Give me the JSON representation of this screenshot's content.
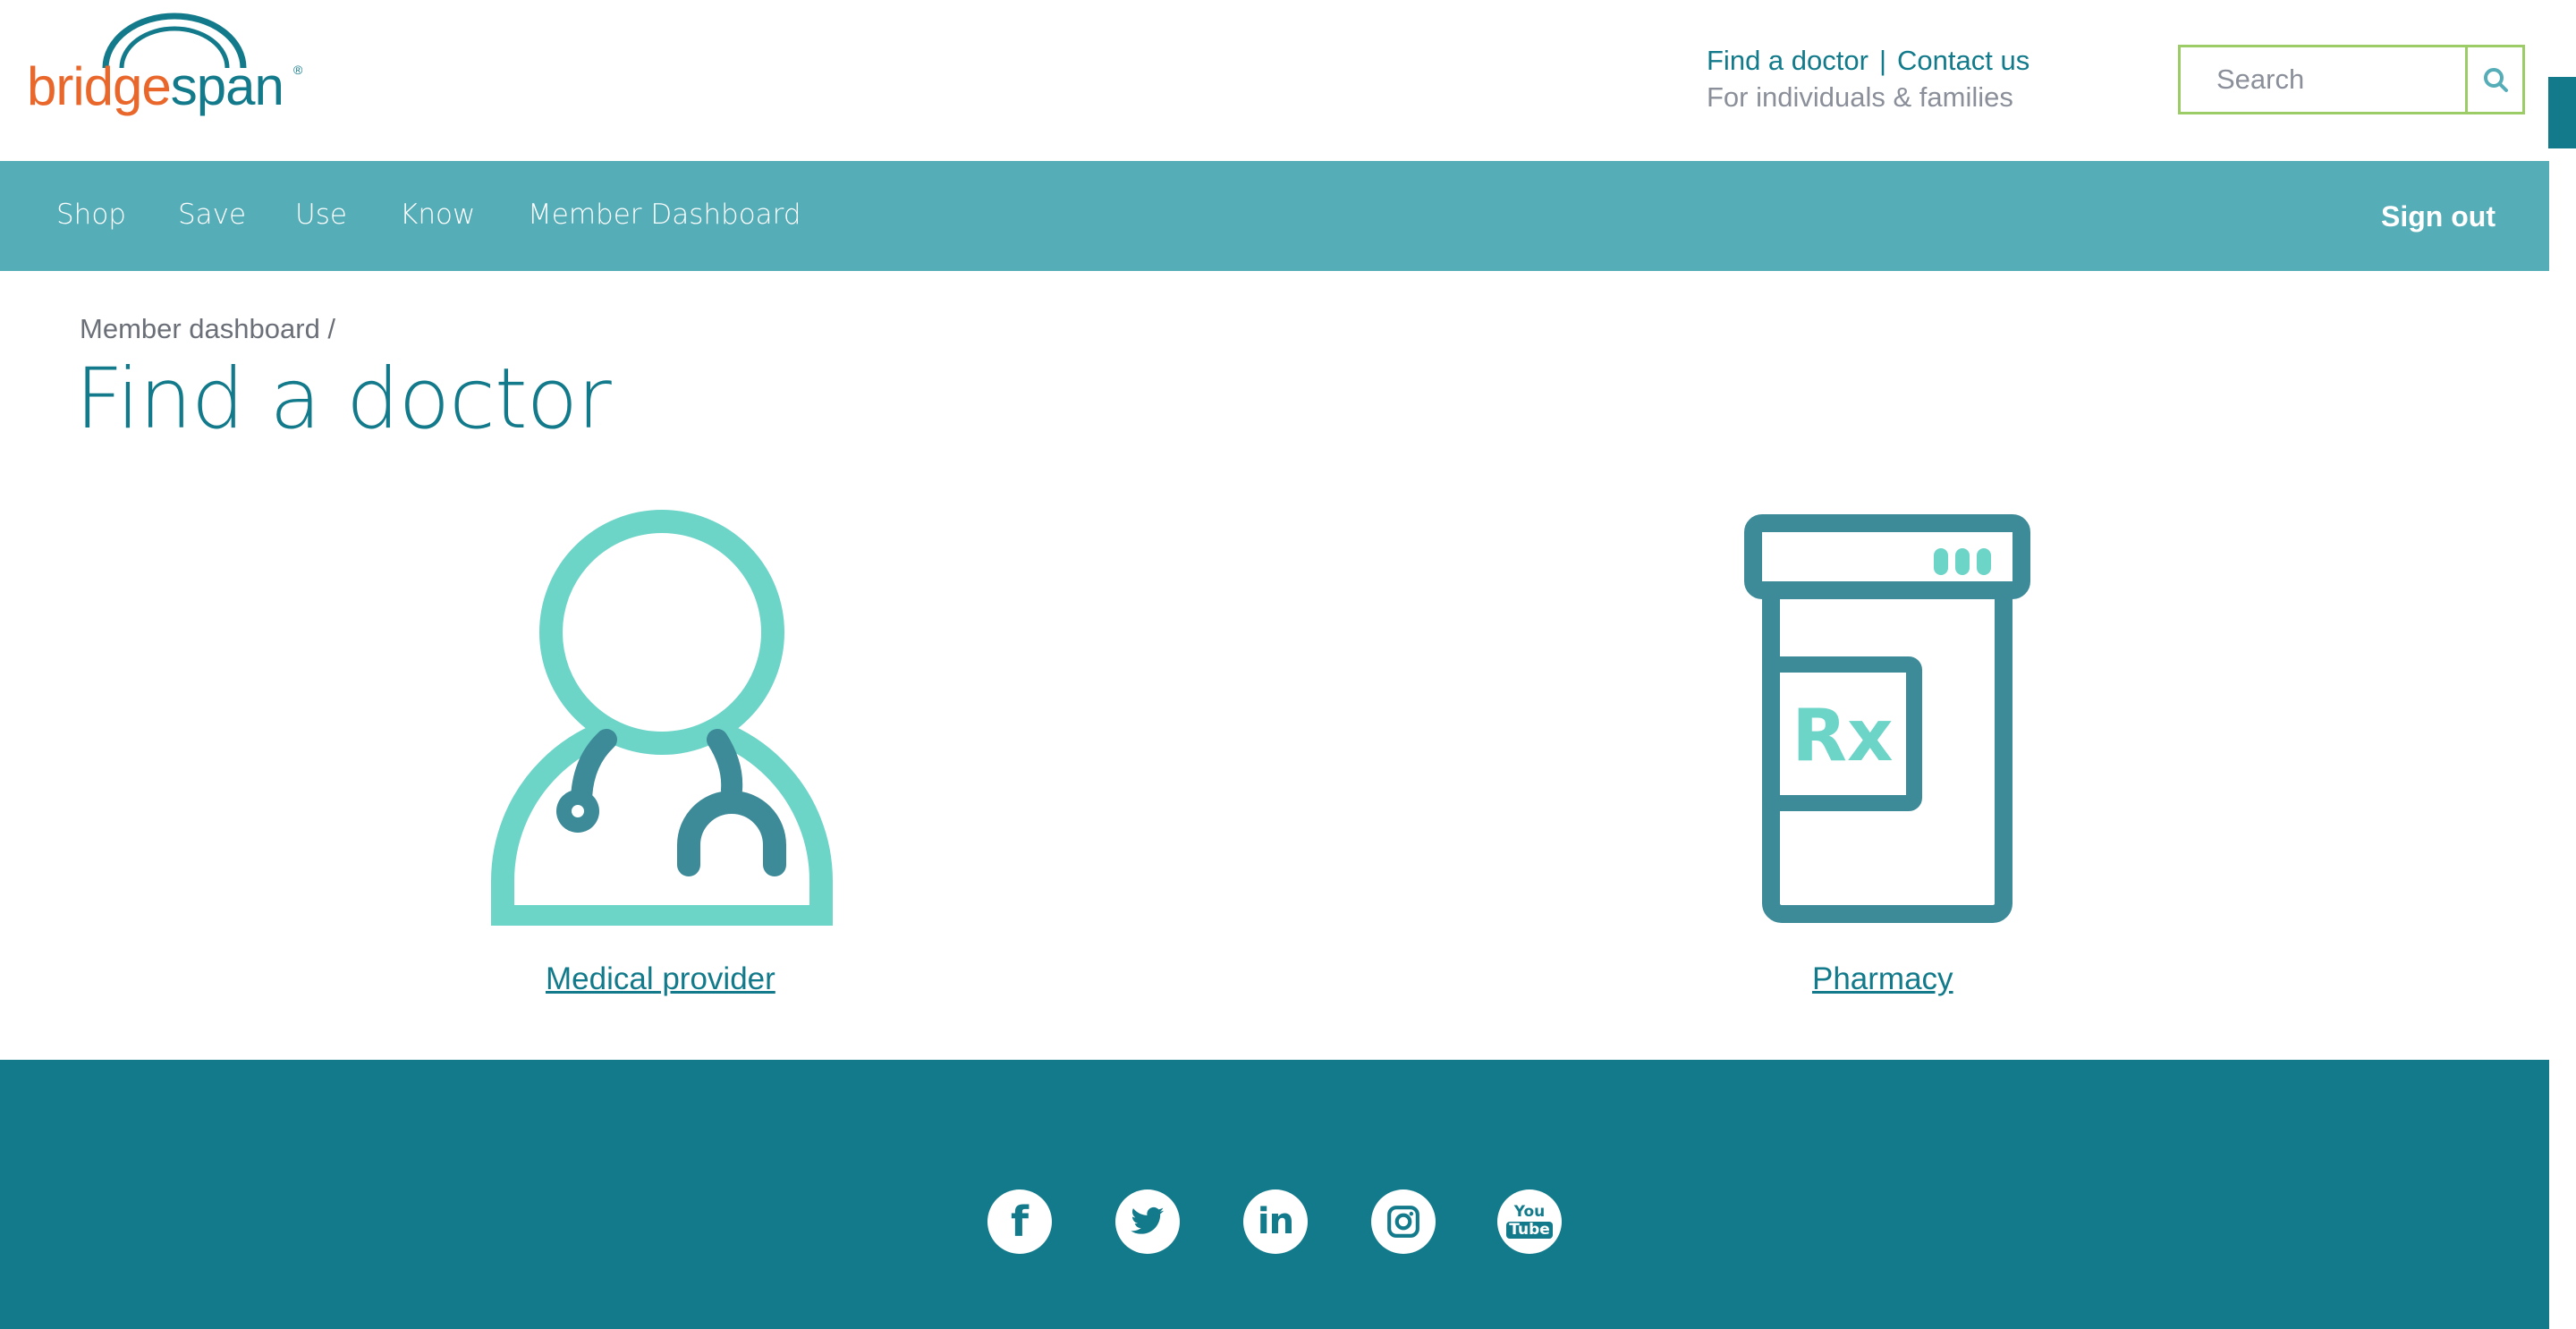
{
  "brand": {
    "logo_part1": "bridge",
    "logo_part2": "span",
    "logo_mark": "®",
    "colors": {
      "orange": "#e9672a",
      "teal_dark": "#127a8a",
      "teal_nav": "#55adb7",
      "teal_light": "#6dd4c8",
      "search_border": "#9ccc65"
    }
  },
  "header": {
    "links": [
      {
        "label": "Find a doctor"
      },
      {
        "label": "Contact us"
      }
    ],
    "separator": "|",
    "tagline": "For individuals & families",
    "search": {
      "placeholder": "Search",
      "icon": "search-icon"
    }
  },
  "nav": {
    "items": [
      {
        "label": "Shop"
      },
      {
        "label": "Save"
      },
      {
        "label": "Use"
      },
      {
        "label": "Know"
      },
      {
        "label": "Member Dashboard"
      }
    ],
    "signout": "Sign out"
  },
  "main": {
    "breadcrumb": "Member dashboard /",
    "title": "Find a doctor",
    "options": [
      {
        "label": "Medical provider",
        "icon": "doctor-stethoscope-icon"
      },
      {
        "label": "Pharmacy",
        "icon": "pill-bottle-rx-icon",
        "icon_text": "Rx"
      }
    ]
  },
  "footer": {
    "social": [
      {
        "name": "facebook-icon",
        "glyph": "f"
      },
      {
        "name": "twitter-icon"
      },
      {
        "name": "linkedin-icon",
        "glyph": "in"
      },
      {
        "name": "instagram-icon"
      },
      {
        "name": "youtube-icon",
        "glyph_top": "You",
        "glyph_bottom": "Tube"
      }
    ]
  }
}
